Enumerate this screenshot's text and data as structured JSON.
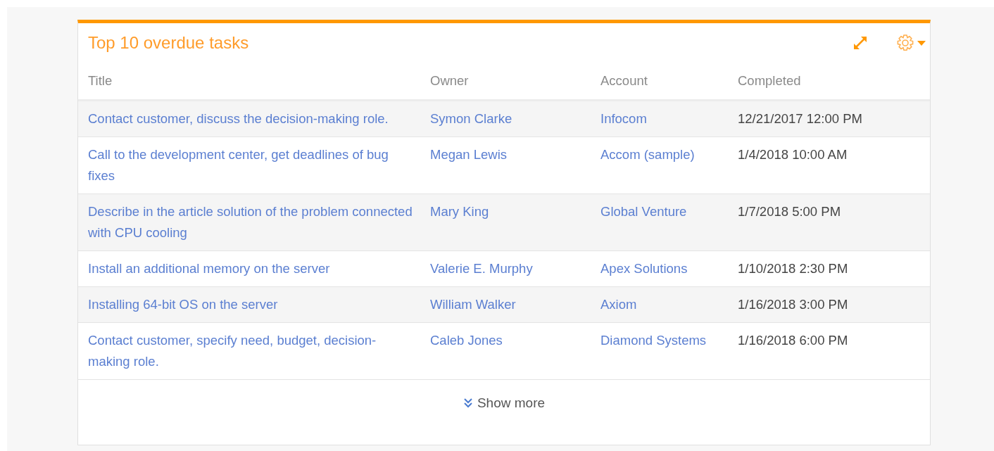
{
  "widget": {
    "title": "Top 10 overdue tasks"
  },
  "table": {
    "columns": [
      "Title",
      "Owner",
      "Account",
      "Completed"
    ],
    "rows": [
      {
        "title": "Contact customer, discuss the decision-making role.",
        "owner": "Symon Clarke",
        "account": "Infocom",
        "completed": "12/21/2017 12:00 PM"
      },
      {
        "title": "Call to the development center, get deadlines of bug fixes",
        "owner": "Megan Lewis",
        "account": "Accom (sample)",
        "completed": "1/4/2018 10:00 AM"
      },
      {
        "title": "Describe in the article solution of the problem connected with CPU cooling",
        "owner": "Mary King",
        "account": "Global Venture",
        "completed": "1/7/2018 5:00 PM"
      },
      {
        "title": "Install an additional memory on the server",
        "owner": "Valerie E. Murphy",
        "account": "Apex Solutions",
        "completed": "1/10/2018 2:30 PM"
      },
      {
        "title": "Installing 64-bit OS on the server",
        "owner": "William Walker",
        "account": "Axiom",
        "completed": "1/16/2018 3:00 PM"
      },
      {
        "title": "Contact customer, specify need, budget, decision-making role.",
        "owner": "Caleb Jones",
        "account": "Diamond Systems",
        "completed": "1/16/2018 6:00 PM"
      }
    ]
  },
  "show_more": "Show more"
}
